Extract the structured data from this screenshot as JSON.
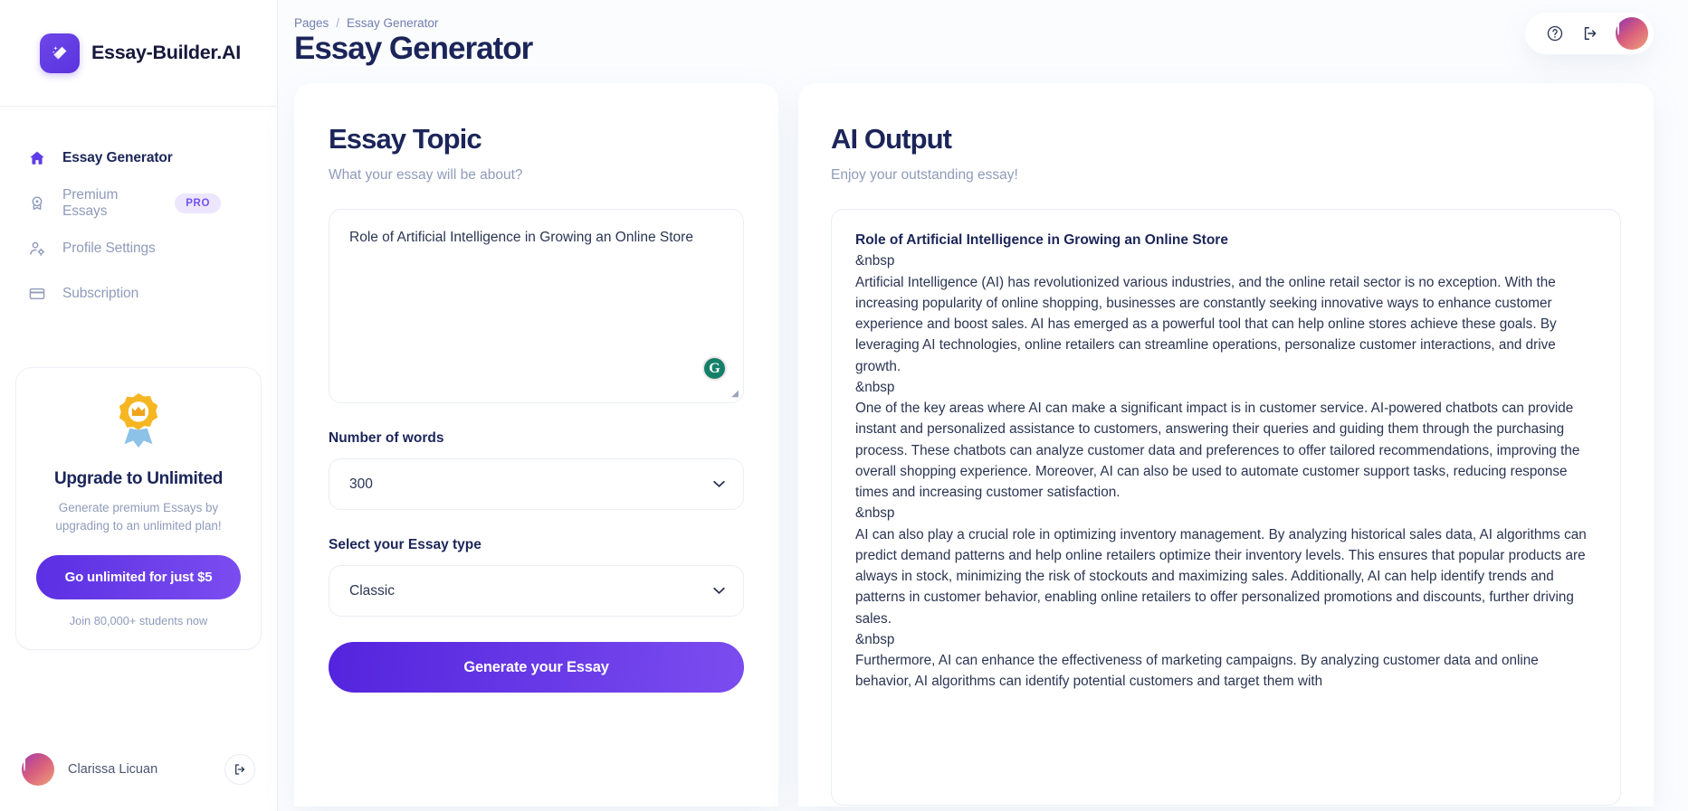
{
  "brand": {
    "name": "Essay-Builder.AI",
    "logo_icon": "magic-wand-icon",
    "accent": "#5a33e0"
  },
  "sidebar": {
    "items": [
      {
        "label": "Essay Generator",
        "icon": "home-icon",
        "active": true,
        "badge": null
      },
      {
        "label": "Premium Essays",
        "icon": "award-icon",
        "active": false,
        "badge": "PRO"
      },
      {
        "label": "Profile Settings",
        "icon": "user-gear-icon",
        "active": false,
        "badge": null
      },
      {
        "label": "Subscription",
        "icon": "credit-card-icon",
        "active": false,
        "badge": null
      }
    ],
    "upsell": {
      "icon": "medal-ribbon-icon",
      "title": "Upgrade to Unlimited",
      "subtitle": "Generate premium Essays by upgrading to an unlimited plan!",
      "cta": "Go unlimited for just $5",
      "note": "Join 80,000+ students now"
    },
    "user": {
      "name": "Clarissa Licuan",
      "avatar": "user-avatar",
      "logout_icon": "logout-icon"
    }
  },
  "header": {
    "breadcrumb": {
      "root": "Pages",
      "separator": "/",
      "current": "Essay Generator"
    },
    "title": "Essay Generator",
    "actions": {
      "help_icon": "question-circle-icon",
      "logout_icon": "logout-icon",
      "avatar": "user-avatar"
    }
  },
  "form": {
    "title": "Essay Topic",
    "subtitle": "What your essay will be about?",
    "topic": {
      "value": "Role of Artificial Intelligence in Growing an Online Store",
      "placeholder": "What your essay will be about?",
      "grammarly_icon": "grammarly-icon",
      "resize_handle": "resize-handle-icon"
    },
    "words": {
      "label": "Number of words",
      "value": "300",
      "chevron_icon": "chevron-down-icon"
    },
    "essay_type": {
      "label": "Select your Essay type",
      "value": "Classic",
      "chevron_icon": "chevron-down-icon"
    },
    "submit": "Generate your Essay"
  },
  "output": {
    "title": "AI Output",
    "subtitle": "Enjoy your outstanding essay!",
    "essay_title": "Role of Artificial Intelligence in Growing an Online Store",
    "nbsp_literal": "&nbsp",
    "paragraphs": [
      "Artificial Intelligence (AI) has revolutionized various industries, and the online retail sector is no exception. With the increasing popularity of online shopping, businesses are constantly seeking innovative ways to enhance customer experience and boost sales. AI has emerged as a powerful tool that can help online stores achieve these goals. By leveraging AI technologies, online retailers can streamline operations, personalize customer interactions, and drive growth.",
      "One of the key areas where AI can make a significant impact is in customer service. AI-powered chatbots can provide instant and personalized assistance to customers, answering their queries and guiding them through the purchasing process. These chatbots can analyze customer data and preferences to offer tailored recommendations, improving the overall shopping experience. Moreover, AI can also be used to automate customer support tasks, reducing response times and increasing customer satisfaction.",
      "AI can also play a crucial role in optimizing inventory management. By analyzing historical sales data, AI algorithms can predict demand patterns and help online retailers optimize their inventory levels. This ensures that popular products are always in stock, minimizing the risk of stockouts and maximizing sales. Additionally, AI can help identify trends and patterns in customer behavior, enabling online retailers to offer personalized promotions and discounts, further driving sales.",
      "Furthermore, AI can enhance the effectiveness of marketing campaigns. By analyzing customer data and online behavior, AI algorithms can identify potential customers and target them with"
    ]
  }
}
